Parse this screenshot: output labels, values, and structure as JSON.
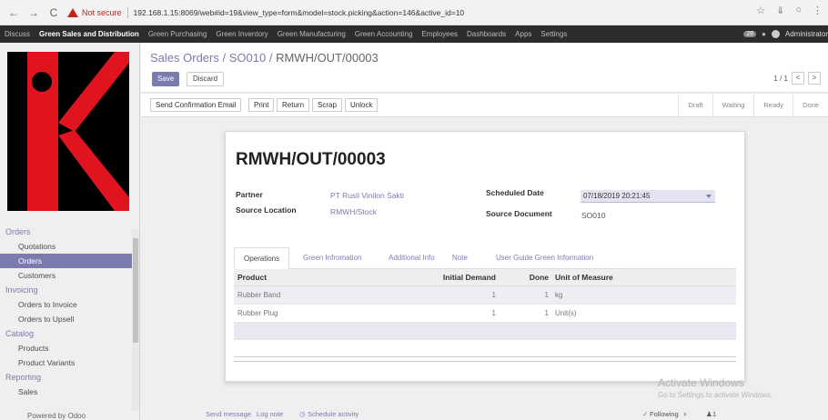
{
  "browser": {
    "not_secure": "Not secure",
    "url": "192.168.1.15:8069/web#id=19&view_type=form&model=stock.picking&action=146&active_id=10"
  },
  "topmenu": {
    "items": [
      "Discuss",
      "Green Sales and Distribution",
      "Green Purchasing",
      "Green Inventory",
      "Green Manufacturing",
      "Green Accounting",
      "Employees",
      "Dashboards",
      "Apps",
      "Settings"
    ],
    "badge": "28",
    "user": "Administrator"
  },
  "sidebar": {
    "sections": [
      {
        "title": "Orders",
        "items": [
          "Quotations",
          "Orders",
          "Customers"
        ]
      },
      {
        "title": "Invoicing",
        "items": [
          "Orders to Invoice",
          "Orders to Upsell"
        ]
      },
      {
        "title": "Catalog",
        "items": [
          "Products",
          "Product Variants"
        ]
      },
      {
        "title": "Reporting",
        "items": [
          "Sales"
        ]
      }
    ],
    "powered": "Powered by Odoo"
  },
  "breadcrumb": {
    "parent": "Sales Orders",
    "order": "SO010",
    "current": "RMWH/OUT/00003"
  },
  "buttons": {
    "save": "Save",
    "discard": "Discard"
  },
  "pager": {
    "value": "1 / 1",
    "prev": "<",
    "next": ">"
  },
  "actions": [
    "Send Confirmation Email",
    "Print",
    "Return",
    "Scrap",
    "Unlock"
  ],
  "stages": [
    "Draft",
    "Waiting",
    "Ready",
    "Done"
  ],
  "form": {
    "title": "RMWH/OUT/00003",
    "partner_label": "Partner",
    "partner_value": "PT Rusli Vinilon Sakti",
    "source_location_label": "Source Location",
    "source_location_value": "RMWH/Stock",
    "scheduled_date_label": "Scheduled Date",
    "scheduled_date_value": "07/18/2019 20:21:45",
    "source_document_label": "Source Document",
    "source_document_value": "SO010"
  },
  "tabs": [
    "Operations",
    "Green Infromation",
    "Additional Info",
    "Note",
    "User Guide Green Information"
  ],
  "table": {
    "headers": {
      "product": "Product",
      "initial": "Initial Demand",
      "done": "Done",
      "uom": "Unit of Measure"
    },
    "rows": [
      {
        "product": "Rubber Band",
        "initial": "1",
        "done": "1",
        "uom": "kg"
      },
      {
        "product": "Rubber Plug",
        "initial": "1",
        "done": "1",
        "uom": "Unit(s)"
      }
    ]
  },
  "chatter": {
    "send": "Send message",
    "log": "Log note",
    "schedule": "Schedule activity",
    "following": "Following",
    "followers": "1"
  },
  "watermark": {
    "title": "Activate Windows",
    "sub": "Go to Settings to activate Windows."
  },
  "colors": {
    "primary": "#7c7bad",
    "logo_red": "#e0141e"
  }
}
